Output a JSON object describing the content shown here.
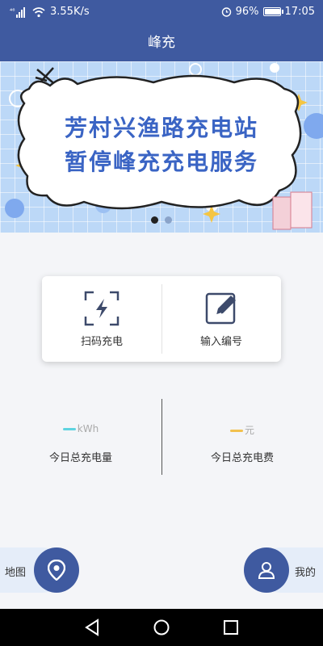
{
  "status_bar": {
    "signal": "⁴⁶",
    "net_speed": "3.55K/s",
    "battery_percent": "96%",
    "battery_level": 0.96,
    "time": "17:05",
    "icons": [
      "signal-icon",
      "wifi-icon",
      "alarm-icon",
      "battery-icon"
    ]
  },
  "header": {
    "title": "峰充"
  },
  "banner": {
    "line1": "芳村兴渔路充电站",
    "line2": "暂停峰充充电服务",
    "page_count": 2,
    "active_page": 1
  },
  "actions": {
    "scan": {
      "label": "扫码充电",
      "icon": "scan-charge-icon"
    },
    "input": {
      "label": "输入编号",
      "icon": "edit-number-icon"
    }
  },
  "stats": {
    "energy": {
      "value": "--",
      "unit": "kWh",
      "label": "今日总充电量",
      "dash_color": "#5ed3e0"
    },
    "fee": {
      "value": "--",
      "unit": "元",
      "label": "今日总充电费",
      "dash_color": "#f2c14e"
    }
  },
  "bottom": {
    "map_label": "地图",
    "map_icon": "location-pin-icon",
    "mine_label": "我的",
    "mine_icon": "user-icon"
  },
  "nav": {
    "icons": [
      "back-icon",
      "home-icon",
      "recents-icon"
    ]
  },
  "colors": {
    "primary": "#3f5aa0",
    "banner_text": "#3a64c4",
    "background": "#f4f5f8"
  }
}
